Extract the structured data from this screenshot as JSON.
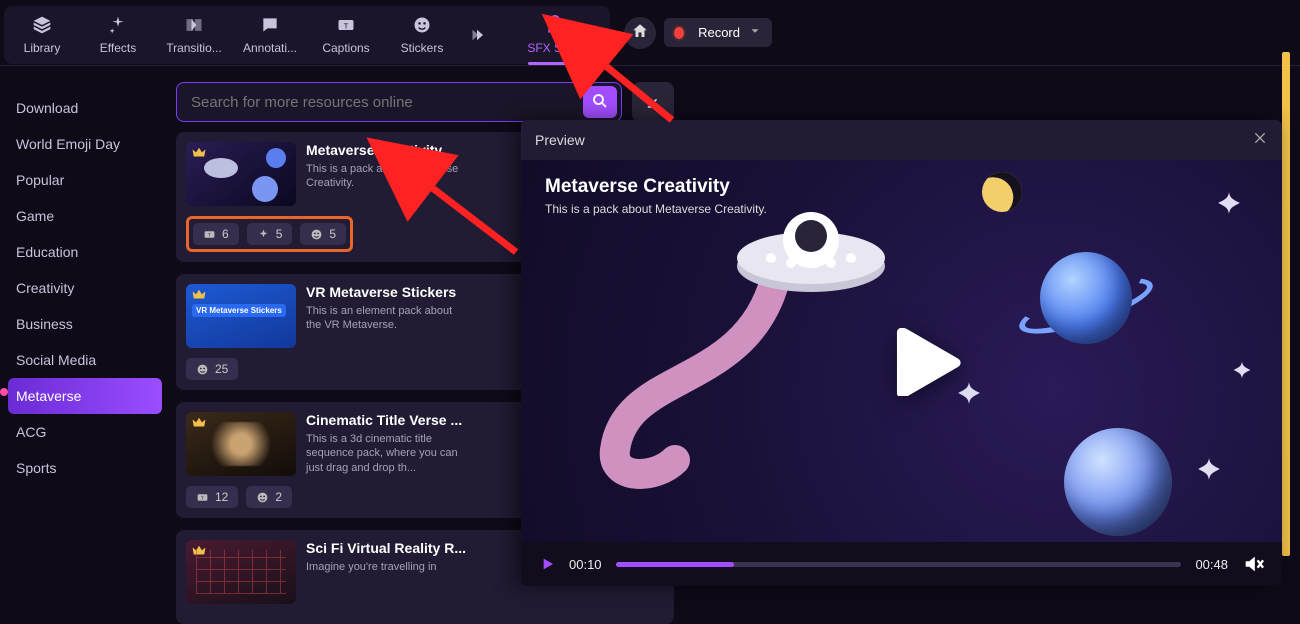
{
  "tabs": {
    "library": "Library",
    "effects": "Effects",
    "transitions": "Transitio...",
    "annotations": "Annotati...",
    "captions": "Captions",
    "stickers": "Stickers",
    "sfx": "SFX Store"
  },
  "topbar": {
    "record": "Record"
  },
  "search": {
    "placeholder": "Search for more resources online"
  },
  "sidebar": {
    "items": [
      "Download",
      "World Emoji Day",
      "Popular",
      "Game",
      "Education",
      "Creativity",
      "Business",
      "Social Media",
      "Metaverse",
      "ACG",
      "Sports"
    ],
    "active_index": 8
  },
  "packs": [
    {
      "title": "Metaverse Creativity",
      "desc": "This is a pack about Metaverse Creativity.",
      "chips": [
        {
          "icon": "caption",
          "count": "6"
        },
        {
          "icon": "effect",
          "count": "5"
        },
        {
          "icon": "sticker",
          "count": "5"
        }
      ],
      "highlight": true
    },
    {
      "title": "VR Metaverse Stickers",
      "desc": "This is an element pack about the VR Metaverse.",
      "chips": [
        {
          "icon": "sticker",
          "count": "25"
        }
      ]
    },
    {
      "title": "Cinematic Title Verse ...",
      "desc": "This is a 3d cinematic title sequence pack, where you can just drag and drop th...",
      "chips": [
        {
          "icon": "caption",
          "count": "12"
        },
        {
          "icon": "sticker",
          "count": "2"
        }
      ]
    },
    {
      "title": "Sci Fi Virtual Reality R...",
      "desc": "Imagine you're travelling in",
      "chips": []
    }
  ],
  "preview": {
    "header": "Preview",
    "title": "Metaverse Creativity",
    "desc": "This is a pack about Metaverse Creativity.",
    "time_current": "00:10",
    "time_total": "00:48"
  },
  "colors": {
    "accent": "#a24dff",
    "highlight_border": "#e8652b"
  }
}
